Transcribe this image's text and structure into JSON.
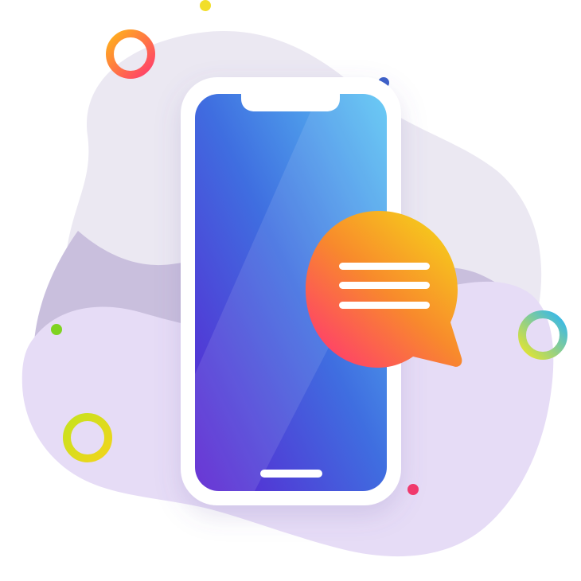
{
  "illustration": {
    "subject": "phone-with-chat-bubble",
    "colors": {
      "background": "#ffffff",
      "blob_back": "#ebe8f2",
      "blob_mid": "#c9bfdd",
      "blob_front": "#e6dcf6",
      "phone_frame": "#ffffff",
      "screen_gradient": [
        "#5bc6f4",
        "#3f6ee0",
        "#5a1fd0"
      ],
      "bubble_gradient": [
        "#f6d11a",
        "#f88a2c",
        "#ff3c6d"
      ],
      "bubble_lines": "#ffffff"
    },
    "icons": [
      "phone-icon",
      "chat-bubble-icon",
      "ring-orange-icon",
      "ring-blue-yellow-icon",
      "ring-green-icon"
    ],
    "decorations": {
      "dots": [
        "#f2de2a",
        "#3d60c8",
        "#7fd321",
        "#f3396b"
      ]
    }
  }
}
